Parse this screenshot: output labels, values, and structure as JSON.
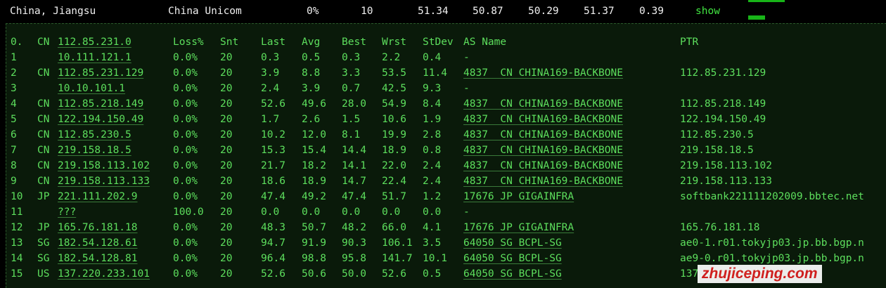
{
  "summary": {
    "location": "China, Jiangsu",
    "isp": "China Unicom",
    "loss": "0%",
    "sent": "10",
    "last": "51.34",
    "avg": "50.87",
    "best": "50.29",
    "worst": "51.37",
    "stdev": "0.39",
    "show_label": "show"
  },
  "header": {
    "num": "0.",
    "cc": "CN",
    "host": "112.85.231.0",
    "loss": "Loss%",
    "snt": "Snt",
    "last": "Last",
    "avg": "Avg",
    "best": "Best",
    "wrst": "Wrst",
    "stdev": "StDev",
    "asname": "AS Name",
    "ptr": "PTR"
  },
  "hops": [
    {
      "num": "1",
      "cc": "",
      "host": "10.111.121.1",
      "loss": "0.0%",
      "snt": "20",
      "last": "0.3",
      "avg": "0.5",
      "best": "0.3",
      "wrst": "2.2",
      "stdev": "0.4",
      "asname": "-",
      "ptr": ""
    },
    {
      "num": "2",
      "cc": "CN",
      "host": "112.85.231.129",
      "loss": "0.0%",
      "snt": "20",
      "last": "3.9",
      "avg": "8.8",
      "best": "3.3",
      "wrst": "53.5",
      "stdev": "11.4",
      "asname": "4837  CN CHINA169-BACKBONE",
      "ptr": "112.85.231.129"
    },
    {
      "num": "3",
      "cc": "",
      "host": "10.10.101.1",
      "loss": "0.0%",
      "snt": "20",
      "last": "2.4",
      "avg": "3.9",
      "best": "0.7",
      "wrst": "42.5",
      "stdev": "9.3",
      "asname": "-",
      "ptr": ""
    },
    {
      "num": "4",
      "cc": "CN",
      "host": "112.85.218.149",
      "loss": "0.0%",
      "snt": "20",
      "last": "52.6",
      "avg": "49.6",
      "best": "28.0",
      "wrst": "54.9",
      "stdev": "8.4",
      "asname": "4837  CN CHINA169-BACKBONE",
      "ptr": "112.85.218.149"
    },
    {
      "num": "5",
      "cc": "CN",
      "host": "122.194.150.49",
      "loss": "0.0%",
      "snt": "20",
      "last": "1.7",
      "avg": "2.6",
      "best": "1.5",
      "wrst": "10.6",
      "stdev": "1.9",
      "asname": "4837  CN CHINA169-BACKBONE",
      "ptr": "122.194.150.49"
    },
    {
      "num": "6",
      "cc": "CN",
      "host": "112.85.230.5",
      "loss": "0.0%",
      "snt": "20",
      "last": "10.2",
      "avg": "12.0",
      "best": "8.1",
      "wrst": "19.9",
      "stdev": "2.8",
      "asname": "4837  CN CHINA169-BACKBONE",
      "ptr": "112.85.230.5"
    },
    {
      "num": "7",
      "cc": "CN",
      "host": "219.158.18.5",
      "loss": "0.0%",
      "snt": "20",
      "last": "15.3",
      "avg": "15.4",
      "best": "14.4",
      "wrst": "18.9",
      "stdev": "0.8",
      "asname": "4837  CN CHINA169-BACKBONE",
      "ptr": "219.158.18.5"
    },
    {
      "num": "8",
      "cc": "CN",
      "host": "219.158.113.102",
      "loss": "0.0%",
      "snt": "20",
      "last": "21.7",
      "avg": "18.2",
      "best": "14.1",
      "wrst": "22.0",
      "stdev": "2.4",
      "asname": "4837  CN CHINA169-BACKBONE",
      "ptr": "219.158.113.102"
    },
    {
      "num": "9",
      "cc": "CN",
      "host": "219.158.113.133",
      "loss": "0.0%",
      "snt": "20",
      "last": "18.6",
      "avg": "18.9",
      "best": "14.7",
      "wrst": "22.4",
      "stdev": "2.4",
      "asname": "4837  CN CHINA169-BACKBONE",
      "ptr": "219.158.113.133"
    },
    {
      "num": "10",
      "cc": "JP",
      "host": "221.111.202.9",
      "loss": "0.0%",
      "snt": "20",
      "last": "47.4",
      "avg": "49.2",
      "best": "47.4",
      "wrst": "51.7",
      "stdev": "1.2",
      "asname": "17676 JP GIGAINFRA",
      "ptr": "softbank221111202009.bbtec.net"
    },
    {
      "num": "11",
      "cc": "",
      "host": "???",
      "loss": "100.0",
      "snt": "20",
      "last": "0.0",
      "avg": "0.0",
      "best": "0.0",
      "wrst": "0.0",
      "stdev": "0.0",
      "asname": "-",
      "ptr": ""
    },
    {
      "num": "12",
      "cc": "JP",
      "host": "165.76.181.18",
      "loss": "0.0%",
      "snt": "20",
      "last": "48.3",
      "avg": "50.7",
      "best": "48.2",
      "wrst": "66.0",
      "stdev": "4.1",
      "asname": "17676 JP GIGAINFRA",
      "ptr": "165.76.181.18"
    },
    {
      "num": "13",
      "cc": "SG",
      "host": "182.54.128.61",
      "loss": "0.0%",
      "snt": "20",
      "last": "94.7",
      "avg": "91.9",
      "best": "90.3",
      "wrst": "106.1",
      "stdev": "3.5",
      "asname": "64050 SG BCPL-SG",
      "ptr": "ae0-1.r01.tokyjp03.jp.bb.bgp.n"
    },
    {
      "num": "14",
      "cc": "SG",
      "host": "182.54.128.81",
      "loss": "0.0%",
      "snt": "20",
      "last": "96.4",
      "avg": "98.8",
      "best": "95.8",
      "wrst": "141.7",
      "stdev": "10.1",
      "asname": "64050 SG BCPL-SG",
      "ptr": "ae9-0.r01.tokyjp03.jp.bb.bgp.n"
    },
    {
      "num": "15",
      "cc": "US",
      "host": "137.220.233.101",
      "loss": "0.0%",
      "snt": "20",
      "last": "52.6",
      "avg": "50.6",
      "best": "50.0",
      "wrst": "52.6",
      "stdev": "0.5",
      "asname": "64050 SG BCPL-SG",
      "ptr": "137.220.233.101"
    }
  ],
  "watermark": "zhujiceping.com",
  "colors": {
    "background": "#000000",
    "panel": "#0a1a0a",
    "text_green": "#5ddf5d",
    "summary_text": "#f0f0f0",
    "watermark_red": "#e02020"
  }
}
